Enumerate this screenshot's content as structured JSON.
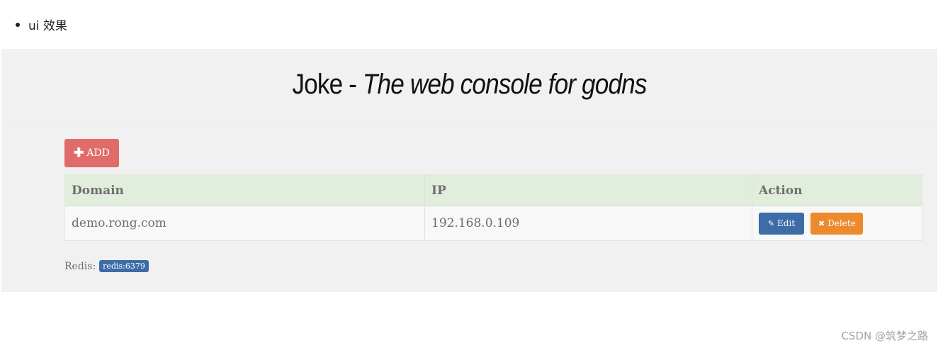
{
  "bullet": {
    "text": "ui 效果"
  },
  "app": {
    "title_prefix": "Joke - ",
    "title_italic": "The web console for godns"
  },
  "toolbar": {
    "add_label": "ADD"
  },
  "table": {
    "headers": [
      "Domain",
      "IP",
      "Action"
    ],
    "rows": [
      {
        "domain": "demo.rong.com",
        "ip": "192.168.0.109",
        "edit_label": "Edit",
        "delete_label": "Delete"
      }
    ]
  },
  "redis": {
    "label": "Redis:",
    "value": "redis:6379"
  },
  "watermark": {
    "text": "CSDN @筑梦之路"
  },
  "colors": {
    "add": "#e06c6a",
    "edit": "#3e6ca6",
    "delete": "#ec8a2d",
    "header_bg": "#e2eedd"
  }
}
